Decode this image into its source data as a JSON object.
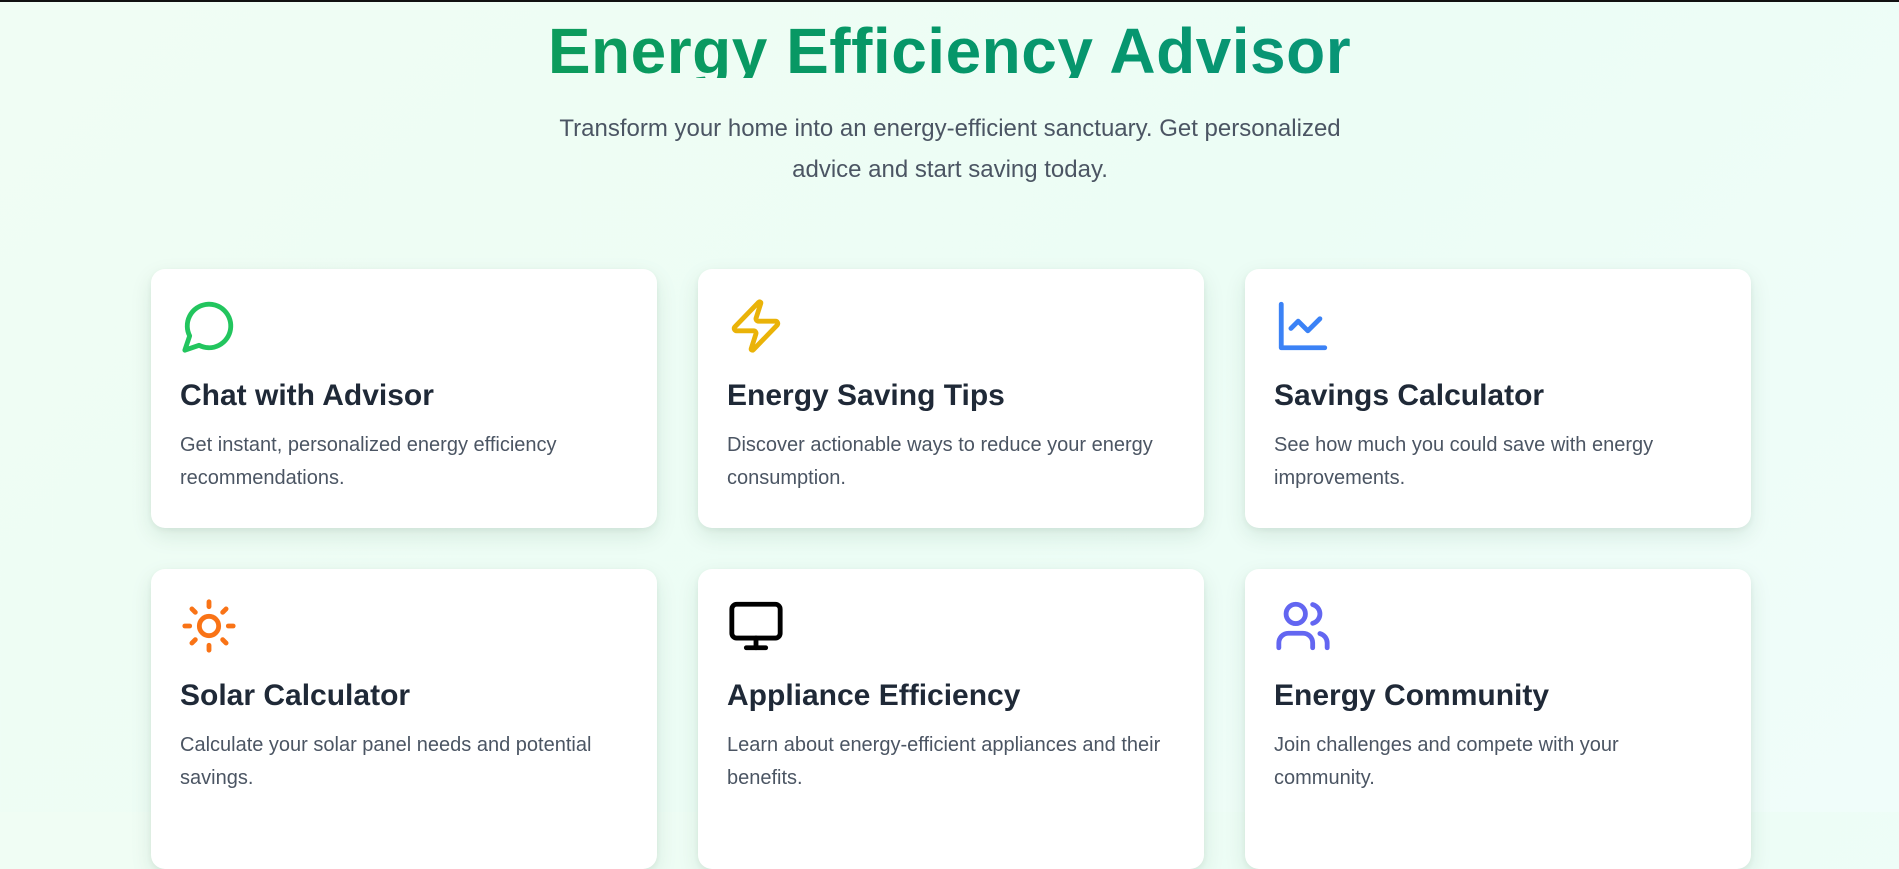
{
  "hero": {
    "title": "Energy Efficiency Advisor",
    "subtitle": "Transform your home into an energy-efficient sanctuary. Get personalized advice and start saving today."
  },
  "colors": {
    "title_gradient": [
      "#16a34a",
      "#059669",
      "#0d9488"
    ],
    "background": "#ecfdf5",
    "card": "#ffffff",
    "heading": "#1f2937",
    "body_text": "#4b5563"
  },
  "features": [
    {
      "icon": "message-circle-icon",
      "icon_color": "#22c55e",
      "title": "Chat with Advisor",
      "description": "Get instant, personalized energy efficiency recommendations."
    },
    {
      "icon": "zap-icon",
      "icon_color": "#eab308",
      "title": "Energy Saving Tips",
      "description": "Discover actionable ways to reduce your energy consumption."
    },
    {
      "icon": "line-chart-icon",
      "icon_color": "#3b82f6",
      "title": "Savings Calculator",
      "description": "See how much you could save with energy improvements."
    },
    {
      "icon": "sun-icon",
      "icon_color": "#f97316",
      "title": "Solar Calculator",
      "description": "Calculate your solar panel needs and potential savings."
    },
    {
      "icon": "monitor-icon",
      "icon_color": "#000000",
      "title": "Appliance Efficiency",
      "description": "Learn about energy-efficient appliances and their benefits."
    },
    {
      "icon": "users-icon",
      "icon_color": "#6366f1",
      "title": "Energy Community",
      "description": "Join challenges and compete with your community."
    }
  ]
}
